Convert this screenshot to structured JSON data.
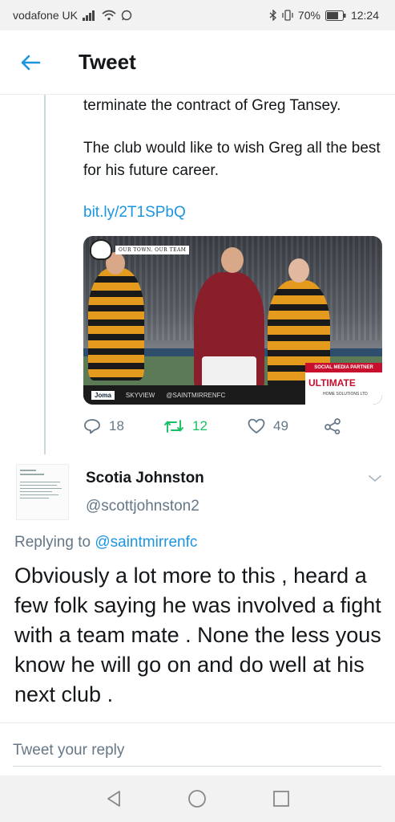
{
  "status_bar": {
    "carrier": "vodafone UK",
    "battery": "70%",
    "time": "12:24"
  },
  "header": {
    "title": "Tweet"
  },
  "tweet": {
    "text_line1": "terminate the contract of Greg Tansey.",
    "text_para2": "The club would like to wish Greg all the best for his future career.",
    "link": "bit.ly/2T1SPbQ",
    "media": {
      "top_tag": "OUR TOWN. OUR TEAM",
      "partner_label": "SOCIAL MEDIA PARTNER",
      "partner_name": "ULTIMATE",
      "partner_sub": "HOME SOLUTIONS LTD",
      "sponsor1": "Joma",
      "sponsor2": "SKYVIEW",
      "social_handle": "@SAINTMIRRENFC"
    },
    "stats": {
      "replies": "18",
      "retweets": "12",
      "likes": "49"
    }
  },
  "reply": {
    "name": "Scotia Johnston",
    "handle": "@scottjohnston2",
    "replying_prefix": "Replying to",
    "replying_to": "@saintmirrenfc",
    "text": "Obviously a lot more to this , heard a few folk saying he was involved a fight with a team mate . None the less yous know he will go on and do well at his next club ."
  },
  "compose": {
    "placeholder": "Tweet your reply"
  },
  "colors": {
    "accent": "#1b95e0",
    "retweet_green": "#17bf63",
    "muted": "#657786"
  }
}
